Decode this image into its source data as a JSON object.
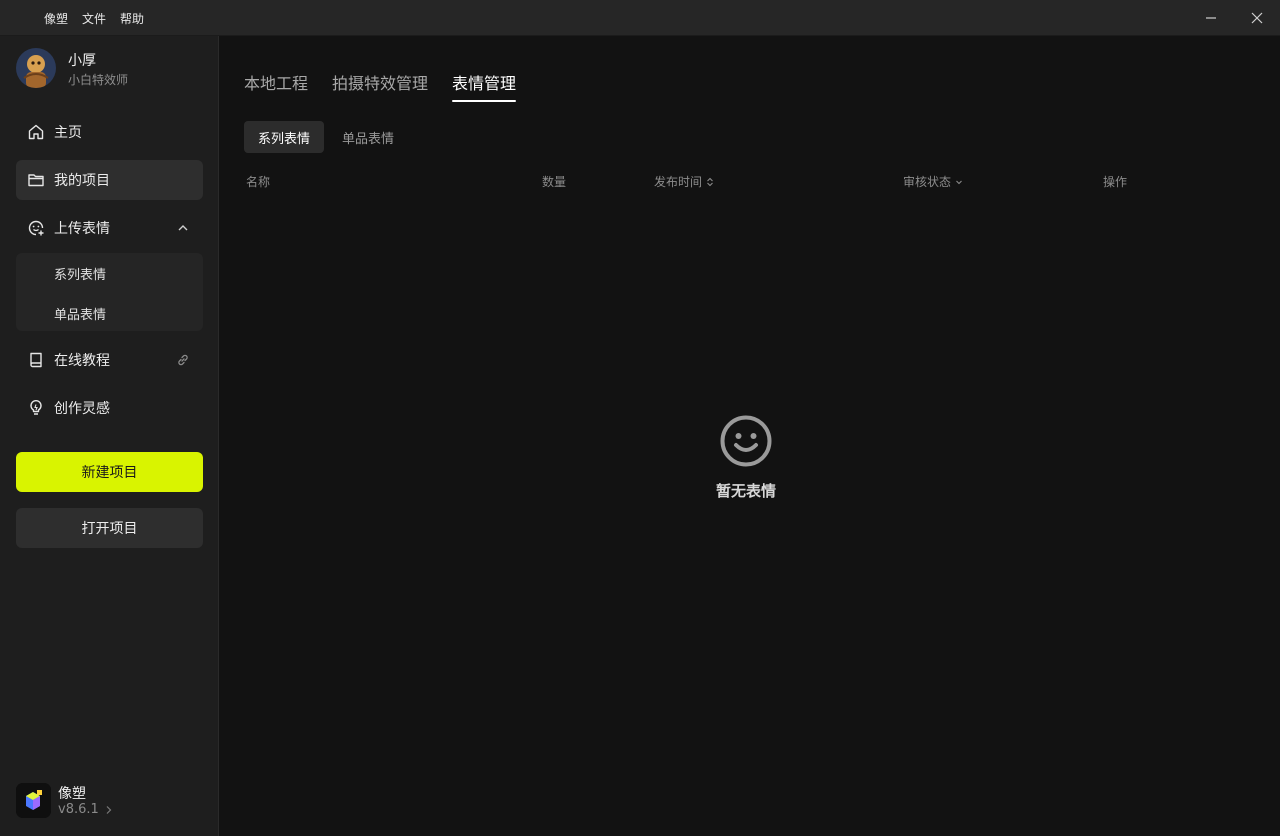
{
  "menubar": {
    "items": [
      "像塑",
      "文件",
      "帮助"
    ]
  },
  "user": {
    "name": "小厚",
    "role": "小白特效师"
  },
  "sidebar": {
    "home": "主页",
    "projects": "我的项目",
    "upload": "上传表情",
    "upload_sub": [
      "系列表情",
      "单品表情"
    ],
    "tutorial": "在线教程",
    "inspiration": "创作灵感"
  },
  "buttons": {
    "new_project": "新建项目",
    "open_project": "打开项目"
  },
  "app": {
    "name": "像塑",
    "version": "v8.6.1"
  },
  "tabs": [
    "本地工程",
    "拍摄特效管理",
    "表情管理"
  ],
  "active_tab": "表情管理",
  "subtabs": [
    "系列表情",
    "单品表情"
  ],
  "table": {
    "columns": [
      "名称",
      "数量",
      "发布时间",
      "审核状态",
      "操作"
    ]
  },
  "empty": {
    "text": "暂无表情"
  },
  "colors": {
    "accent": "#d9f400",
    "background": "#121212",
    "sidebar": "#1e1e1e"
  }
}
